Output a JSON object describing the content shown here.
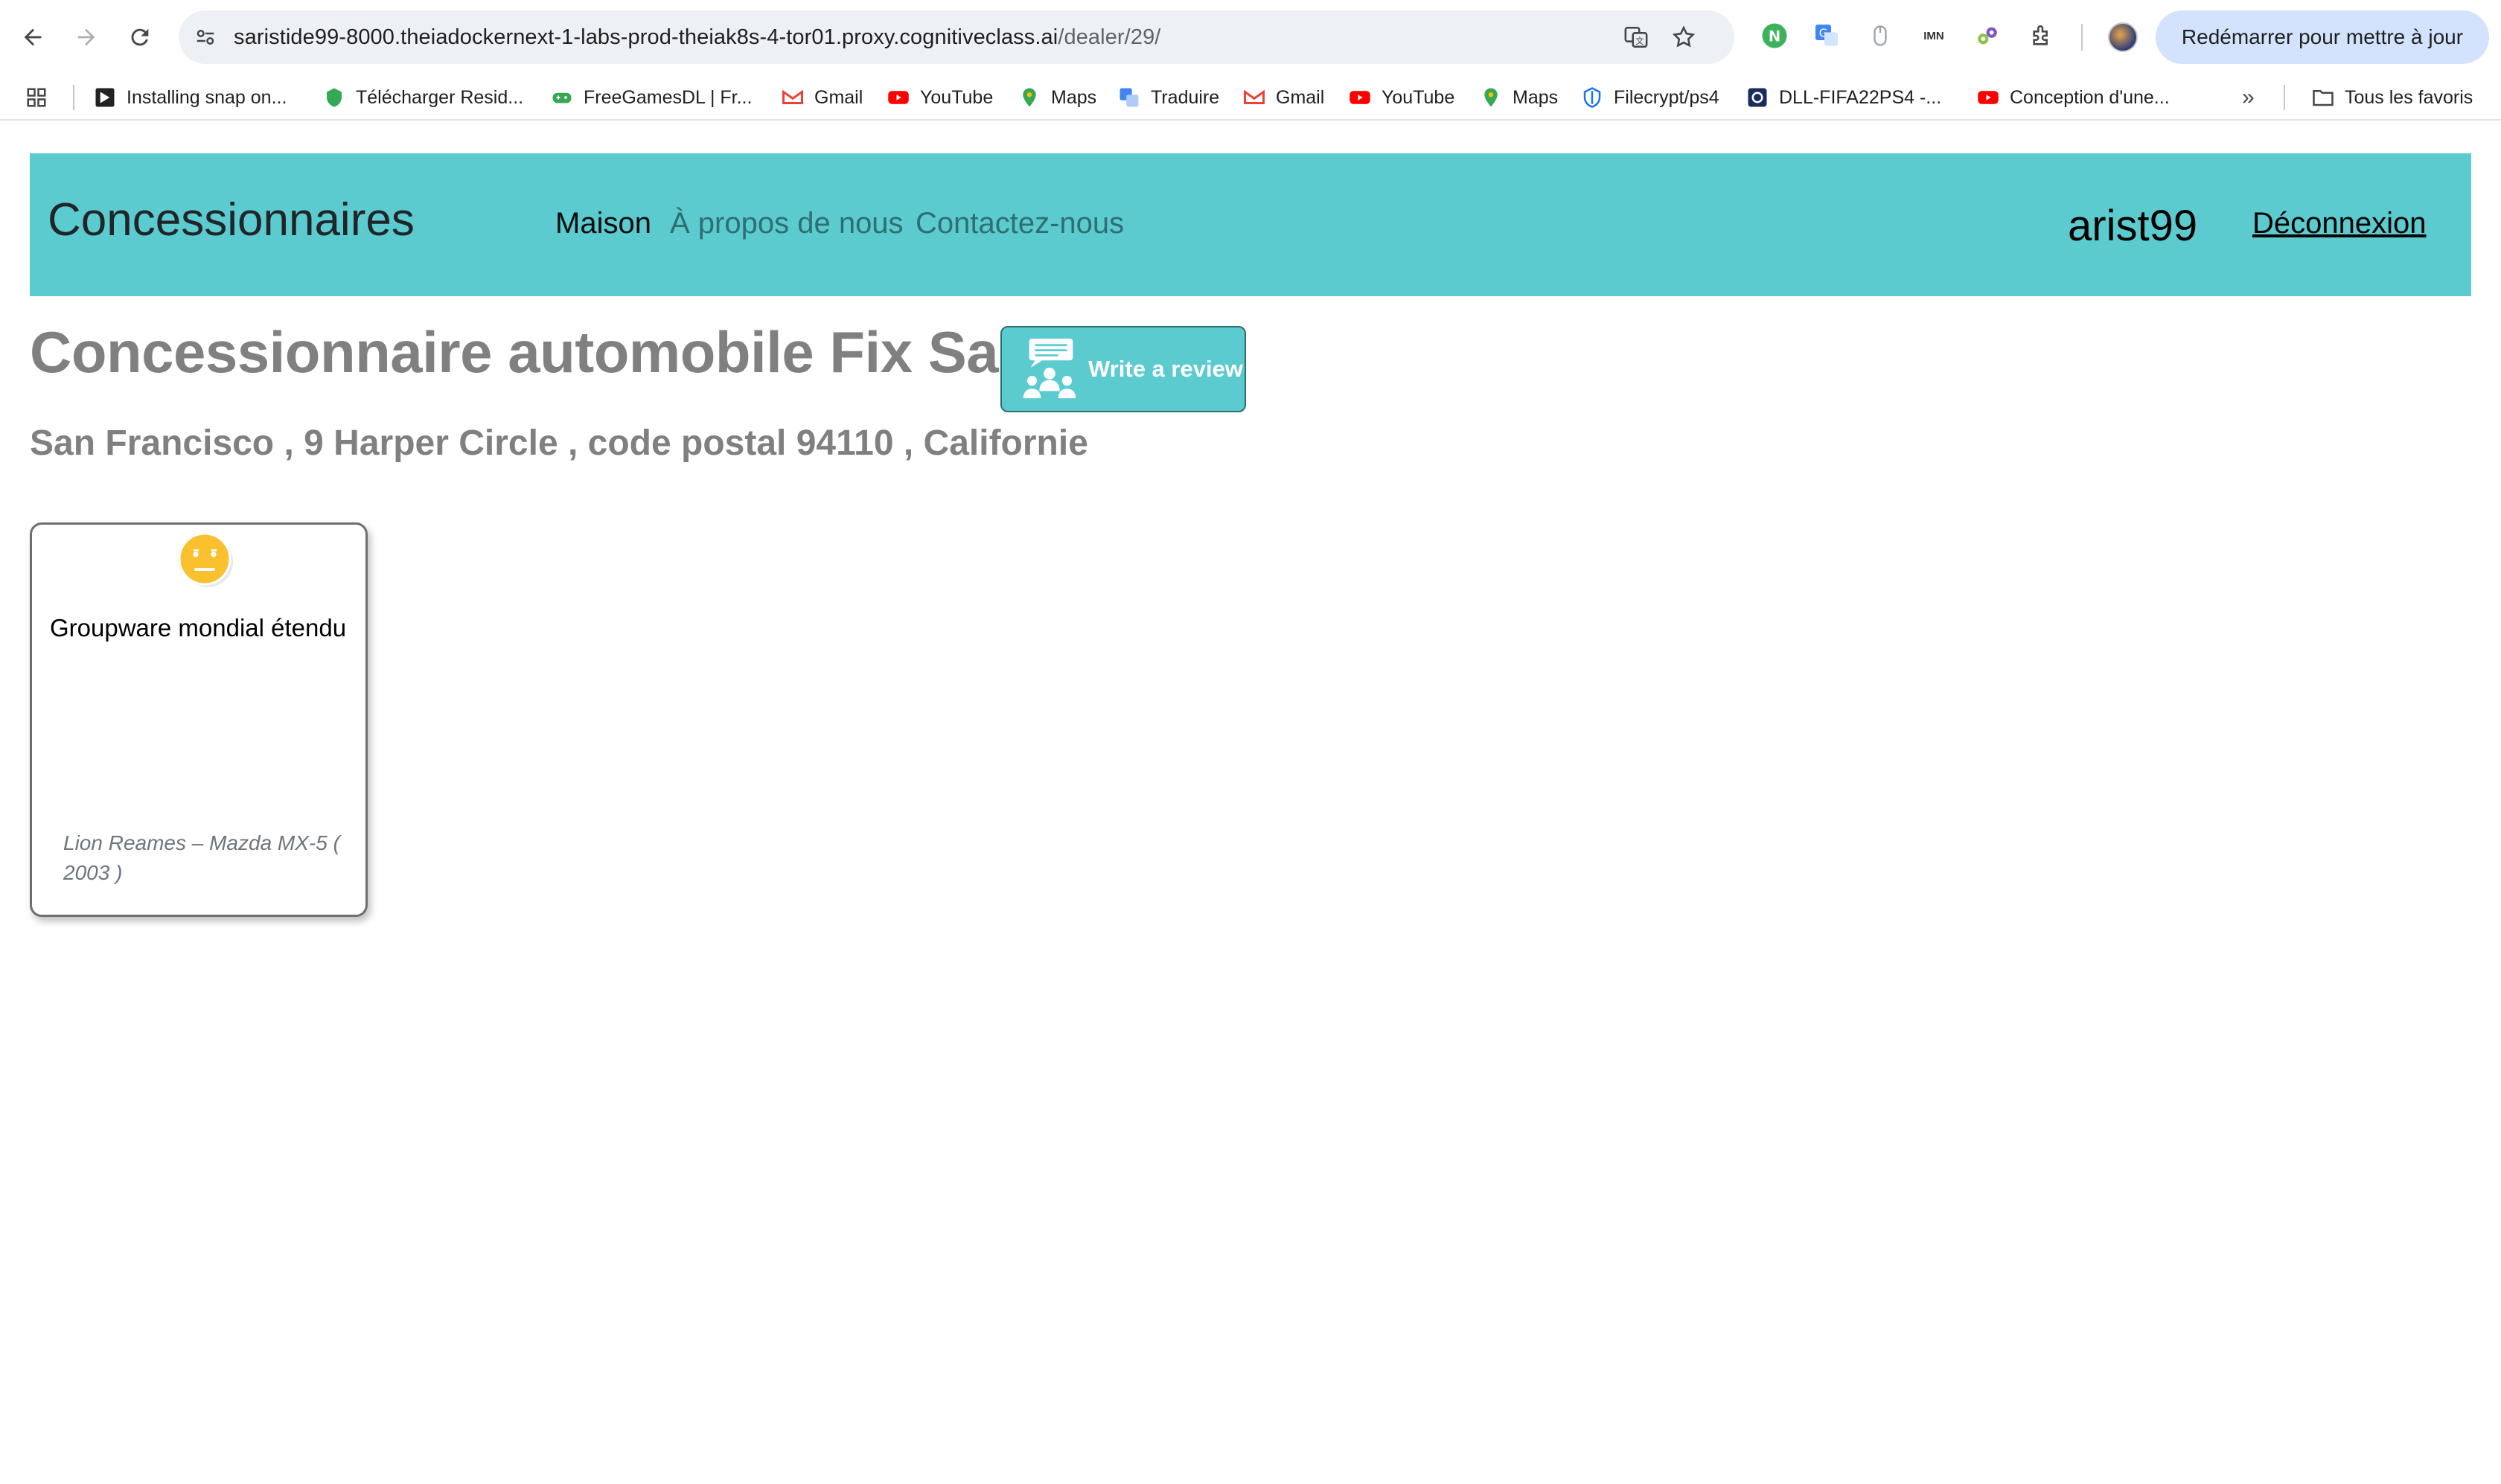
{
  "browser": {
    "url_host": "saristide99-8000.theiadockernext-1-labs-prod-theiak8s-4-tor01.proxy.cognitiveclass.ai",
    "url_path": "/dealer/29/",
    "update_button": "Redémarrer pour mettre à jour",
    "extensions": [
      "n-extension-icon",
      "google-translate-extension-icon",
      "mouse-extension-icon",
      "imn-extension-icon",
      "gear-extension-icon",
      "puzzle-icon"
    ],
    "imn_label": "IMN"
  },
  "bookmarks": {
    "items": [
      {
        "label": "Installing snap on...",
        "icon": "snap-icon"
      },
      {
        "label": "Télécharger Resid...",
        "icon": "green-shield-icon"
      },
      {
        "label": "FreeGamesDL | Fr...",
        "icon": "gamepad-icon"
      },
      {
        "label": "Gmail",
        "icon": "gmail-icon"
      },
      {
        "label": "YouTube",
        "icon": "youtube-icon"
      },
      {
        "label": "Maps",
        "icon": "maps-icon"
      },
      {
        "label": "Traduire",
        "icon": "translate-icon"
      },
      {
        "label": "Gmail",
        "icon": "gmail-icon"
      },
      {
        "label": "YouTube",
        "icon": "youtube-icon"
      },
      {
        "label": "Maps",
        "icon": "maps-icon"
      },
      {
        "label": "Filecrypt/ps4",
        "icon": "shield-icon"
      },
      {
        "label": "DLL-FIFA22PS4 -...",
        "icon": "dll-icon"
      },
      {
        "label": "Conception d'une...",
        "icon": "youtube-icon"
      }
    ],
    "all_bookmarks": "Tous les favoris"
  },
  "navbar": {
    "brand": "Concessionnaires",
    "links": [
      {
        "label": "Maison",
        "active": true
      },
      {
        "label": "À propos de nous",
        "active": false
      },
      {
        "label": "Contactez-nous",
        "active": false
      }
    ],
    "username": "arist99",
    "logout": "Déconnexion"
  },
  "dealer": {
    "title": "Concessionnaire automobile Fix San",
    "address": "San Francisco , 9 Harper Circle , code postal 94110 , Californie",
    "review_button": "Write a review"
  },
  "reviews": [
    {
      "sentiment": "neutral",
      "text": "Groupware mondial étendu",
      "meta": "Lion Reames – Mazda MX-5 ( 2003 )"
    }
  ],
  "colors": {
    "navbar_bg": "#5bcbcf",
    "heading_grey": "#808080",
    "update_button_bg": "#d3e3fd"
  }
}
